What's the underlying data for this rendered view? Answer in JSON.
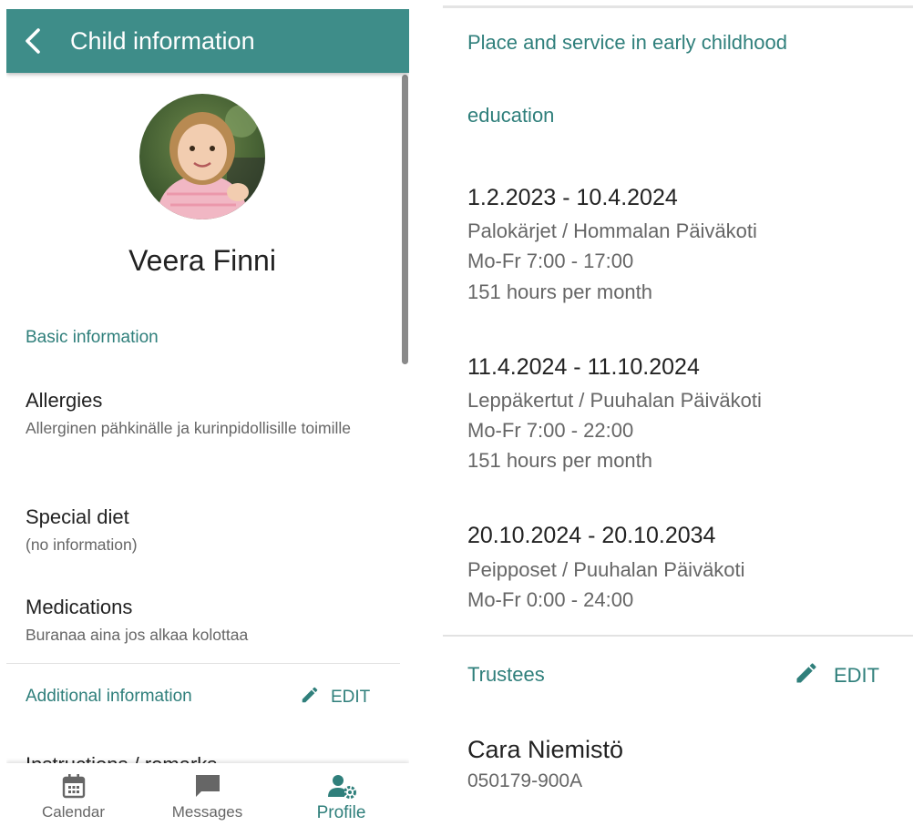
{
  "header": {
    "title": "Child information"
  },
  "child": {
    "name": "Veera Finni"
  },
  "basic": {
    "title": "Basic information",
    "allergies": {
      "label": "Allergies",
      "value": "Allerginen pähkinälle ja kurinpidollisille toimille"
    },
    "diet": {
      "label": "Special diet",
      "value": "(no information)"
    },
    "medications": {
      "label": "Medications",
      "value": "Buranaa aina jos alkaa kolottaa"
    }
  },
  "additional": {
    "title": "Additional information",
    "edit_label": "EDIT",
    "first_field": "Instructions / remarks"
  },
  "nav": {
    "items": [
      {
        "label": "Calendar",
        "icon": "calendar-icon"
      },
      {
        "label": "Messages",
        "icon": "message-icon"
      },
      {
        "label": "Profile",
        "icon": "profile-settings-icon",
        "active": true
      }
    ]
  },
  "placement": {
    "title_line1": "Place and service in early childhood",
    "title_line2": "education",
    "periods": [
      {
        "dates": "1.2.2023 - 10.4.2024",
        "unit": "Palokärjet / Hommalan Päiväkoti",
        "hours": "Mo-Fr 7:00 - 17:00",
        "monthly": "151 hours per month"
      },
      {
        "dates": "11.4.2024 - 11.10.2024",
        "unit": "Leppäkertut / Puuhalan Päiväkoti",
        "hours": "Mo-Fr 7:00 - 22:00",
        "monthly": "151 hours per month"
      },
      {
        "dates": "20.10.2024 - 20.10.2034",
        "unit": "Peipposet / Puuhalan Päiväkoti",
        "hours": "Mo-Fr 0:00 - 24:00"
      }
    ]
  },
  "trustees": {
    "title": "Trustees",
    "edit_label": "EDIT",
    "items": [
      {
        "name": "Cara Niemistö",
        "id": "050179-900A"
      }
    ]
  },
  "colors": {
    "primary": "#3e8d89",
    "accent_text": "#2f7f7b",
    "secondary_text": "#666666"
  }
}
